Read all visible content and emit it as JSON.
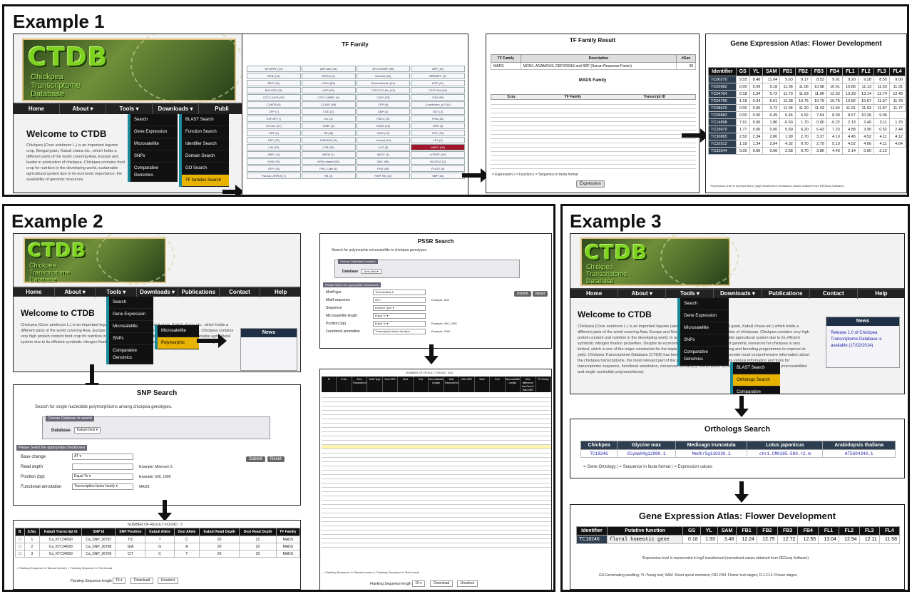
{
  "examples": {
    "e1": "Example 1",
    "e2": "Example 2",
    "e3": "Example 3"
  },
  "banner": {
    "title": "CTDB",
    "sub1": "Chickpea",
    "sub2": "Transcriptome",
    "sub3": "Database"
  },
  "nav": {
    "home": "Home",
    "about": "About ▾",
    "tools": "Tools ▾",
    "downloads": "Downloads ▾",
    "publications": "Publications",
    "contact": "Contact",
    "help": "Help",
    "publ_short": "Publi"
  },
  "welcome": "Welcome to CTDB",
  "tools_menu": [
    "Search",
    "Gene Expression",
    "Microsatellite",
    "SNPs",
    "Comparative Genomics"
  ],
  "search_menu": [
    "BLAST Search",
    "Function Search",
    "Identifier Search",
    "Domain Search",
    "GO Search",
    "TF families Search"
  ],
  "micro_menu": [
    "Microsatellite",
    "Polymorphic"
  ],
  "e3_submenu": [
    "BLAST Search",
    "Orthologs Search",
    "Comparative Expression Search"
  ],
  "tf_family": {
    "title": "TF Family",
    "selected": "MADS (30)",
    "cells": [
      "AP2/ERF (24)",
      "ARF-like (39)",
      "AP2-EREBP (96)",
      "ARF (19)",
      "ARID (11)",
      "ARR-B (9)",
      "Aux/IAA (23)",
      "BBR/BPC (4)",
      "BES1 (5)",
      "bHLH (63)",
      "Bromodomain (14)",
      "bZIP (11)",
      "BHLHRZ (34)",
      "bZIP (63)",
      "C2C2-CO-like (19)",
      "C2C2-Dof (34)",
      "C2C2-GATA (26)",
      "C2C2-YABBY (6)",
      "C2H2 (23)",
      "C3H (55)",
      "CAMTA (5)",
      "CCAAT (46)",
      "CPP (6)",
      "Coactivator_p15 (4)",
      "CPP (7)",
      "CSD (3)",
      "DBP (3)",
      "DDT (2)",
      "E2F-DP (7)",
      "EIL (3)",
      "FAR1 (19)",
      "FHA (18)",
      "GG-like (37)",
      "GeBP (5)",
      "GRAS (45)",
      "GRF (6)",
      "GRF (4)",
      "HB (36)",
      "HMG (10)",
      "HSF (23)",
      "HSF (22)",
      "JUMONJI (11)",
      "Jumonji (11)",
      "LFY (2)",
      "LIM (13)",
      "LOB (35)",
      "LUG (3)",
      "MADS (30)",
      "MBF1 (3)",
      "MED6 (1)",
      "MEDT (1)",
      "mTERF (40)",
      "MYB (76)",
      "MYB-related (53)",
      "NAC (56)",
      "NOZZLE (3)",
      "OFP (15)",
      "PBF-2-like (4)",
      "PHD (36)",
      "PLATZ (8)",
      "Pseudo_ARR-B (7)",
      "RB (4)",
      "RWP-RK (12)",
      "SBP (16)"
    ]
  },
  "tf_result": {
    "title": "TF Family Result",
    "cols": [
      "TF Family",
      "Description",
      "#Gen"
    ],
    "row": [
      "MADS",
      "MCM1, AGAMOUS, DEFICIENS and SRF (Serum Response Factor)",
      "30"
    ],
    "subtitle": "MADS Family",
    "subcols": [
      "S.no.",
      "TF Family",
      "Transcript ID"
    ],
    "button": "Expression",
    "legend": "= Expression | = Function | = Sequence in fasta format"
  },
  "gea1": {
    "title": "Gene Expression Atlas: Flower Development",
    "headers": [
      "Identifier",
      "GS",
      "YL",
      "SAM",
      "FB1",
      "FB2",
      "FB3",
      "FB4",
      "FL1",
      "FL2",
      "FL3",
      "FL4"
    ],
    "rows": [
      [
        "TC00270",
        "9.55",
        "8.48",
        "11.04",
        "9.63",
        "9.17",
        "8.53",
        "9.01",
        "9.20",
        "9.28",
        "8.55",
        "9.00"
      ],
      [
        "TC02682",
        "0.00",
        "5.99",
        "5.18",
        "11.36",
        "11.06",
        "10.98",
        "10.61",
        "10.86",
        "11.13",
        "11.63",
        "11.31"
      ],
      [
        "TC04764",
        "0.18",
        "2.34",
        "5.72",
        "11.70",
        "11.63",
        "11.96",
        "12.32",
        "13.28",
        "13.14",
        "12.74",
        "12.45"
      ],
      [
        "TC04790",
        "1.18",
        "0.34",
        "6.61",
        "11.38",
        "10.75",
        "10.79",
        "10.75",
        "10.82",
        "10.67",
        "11.57",
        "11.78"
      ],
      [
        "TC08620",
        "0.00",
        "0.00",
        "3.72",
        "11.04",
        "11.20",
        "11.43",
        "11.64",
        "11.91",
        "11.93",
        "11.87",
        "11.77"
      ],
      [
        "TC09882",
        "0.00",
        "0.00",
        "6.39",
        "6.46",
        "6.92",
        "7.54",
        "8.30",
        "8.67",
        "10.36",
        "9.96"
      ],
      [
        "TC14898",
        "7.91",
        "0.00",
        "1.80",
        "-0.60",
        "1.70",
        "0.00",
        "-0.22",
        "2.13",
        "2.40",
        "3.11",
        "1.70"
      ],
      [
        "TC29470",
        "1.77",
        "0.00",
        "0.00",
        "5.60",
        "6.20",
        "6.43",
        "7.23",
        "4.88",
        "3.90",
        "0.52",
        "2.44"
      ],
      [
        "TC30865",
        "2.50",
        "2.34",
        "2.80",
        "1.99",
        "2.70",
        "3.37",
        "4.10",
        "4.45",
        "4.52",
        "4.11",
        "4.12"
      ],
      [
        "TC32512",
        "1.18",
        "1.34",
        "2.94",
        "4.32",
        "0.70",
        "2.79",
        "5.10",
        "4.52",
        "4.06",
        "4.11",
        "4.64"
      ],
      [
        "TC32544",
        "0.00",
        "0.00",
        "0.00",
        "2.58",
        "0.70",
        "3.86",
        "4.43",
        "2.14",
        "0.00",
        "2.12"
      ]
    ],
    "footnote": "*Expression level is represented in (log2 transformed normalized values obtained from DEGseq Software)."
  },
  "snp": {
    "title": "SNP Search",
    "intro": "Search for single nucleotide polymorphisms among chickpea genotypes.",
    "db_box": "Choose Database to search",
    "db_label": "Database",
    "db_value": "Kabuli-Desi ▾",
    "params": "Please Select the appropriate checkboxes",
    "fields": [
      [
        "Base change",
        "AT ▾",
        ""
      ],
      [
        "Read depth",
        "",
        "Example: Minimum 3"
      ],
      [
        "Position (bp)",
        "Equal To ▾",
        "Example: 500, 1000"
      ],
      [
        "Functional annotation",
        "Transcription factor family ▾",
        "MADS"
      ]
    ],
    "submit": "Submit",
    "reset": "Reset",
    "result": "NUMBER OF RESULT FOUND : 3",
    "cols": [
      "B",
      "S.No.",
      "Kabuli Transcript Id",
      "SNP Id",
      "SNP Position",
      "Kabuli Allele",
      "Desi Allele",
      "Kabuli Read Depth",
      "Desi Read Depth",
      "TF Family"
    ],
    "rows": [
      [
        "1",
        "Ca_KTC04590",
        "Ca_SNP_36797",
        "T/C",
        "T",
        "C",
        "20",
        "21",
        "MADS"
      ],
      [
        "2",
        "Ca_KTC04590",
        "Ca_SNP_36798",
        "G/A",
        "G",
        "A",
        "20",
        "20",
        "MADS"
      ],
      [
        "3",
        "Ca_KTC04590",
        "Ca_SNP_36799",
        "C/T",
        "C",
        "T",
        "20",
        "20",
        "MADS"
      ]
    ],
    "legend": "= Flanking Sequence in Tabular format | = Flanking Sequence in Text format",
    "flank_label": "Flanking Sequence length",
    "flank_value": "15 ▾",
    "download": "Download",
    "unselect": "Unselect"
  },
  "pssr": {
    "title": "PSSR Search",
    "intro": "Search for polymorphic microsatellite in chickpea genotypes.",
    "db_box": "Choose Database to search",
    "db_label": "Database",
    "db_value": "Desi-Wild ▾",
    "params": "Please Select the appropriate checkboxes",
    "fields": [
      [
        "Motif type",
        "Trinucleotide ▾",
        ""
      ],
      [
        "Motif sequence",
        "ATC",
        "Example: ATA"
      ],
      [
        "Sequence",
        "Desired Type ▾",
        ""
      ],
      [
        "Microsatellite length",
        "Equal To ▾",
        ""
      ],
      [
        "Position (bp)",
        "Equal To ▾",
        "Example: 400, 1000"
      ],
      [
        "Functional annotation",
        "Transcription factor family ▾",
        "Example: CAN"
      ]
    ],
    "submit": "Submit",
    "reset": "Reset",
    "result": "NUMBER OF RESULT FOUND : 304",
    "cols": [
      "B",
      "S.No.",
      "Desi Transcript Id",
      "Motif Type",
      "Desi SSR",
      "Start",
      "End",
      "Microsatellite Length",
      "Wild Transcript Id",
      "Wild SSR",
      "Start",
      "End",
      "Microsatellite Length",
      "Size difference b/w Desi & Wild SSR",
      "TF Family"
    ],
    "legend": "= Flanking Sequence in Tabular format | = Flanking Sequence in Text format",
    "flank_label": "Flanking Sequence length",
    "flank_value": "15 ▾",
    "download": "Download",
    "unselect": "Unselect"
  },
  "news": {
    "title": "News",
    "text": "Release 1.0 of Chickpea Transcriptome Database is available (17/02/2014)"
  },
  "orthologs": {
    "title": "Orthologs Search",
    "cols": [
      "Chickpea",
      "Glycine max",
      "Medicago truncatula",
      "Lotus japonicus",
      "Arabidopsis thaliana"
    ],
    "row": [
      "TC18246",
      "Glyma04g12980.1",
      "Medtr5g110330.1",
      "chr1.CM0185.580.r2.m",
      "AT5G04340.1"
    ],
    "legend": "= Gene Ontology | = Sequence in fasta format | = Expression values"
  },
  "gea3": {
    "title": "Gene Expression Atlas: Flower Development",
    "headers": [
      "Identifier",
      "Putative function",
      "GS",
      "YL",
      "SAM",
      "FB1",
      "FB2",
      "FB3",
      "FB4",
      "FL1",
      "FL2",
      "FL3",
      "FL4"
    ],
    "row": [
      "TC18246",
      "floral homeotic gene",
      "0.18",
      "1.93",
      "3.48",
      "12.24",
      "12.75",
      "12.72",
      "12.55",
      "13.04",
      "12.94",
      "12.11",
      "11.58"
    ],
    "note1": "*Expression level is represented in log2 transformed (normalized values obtained from DEGseq Software).",
    "note2": "GS:Germinating seedling; YL:Young leaf; SAM: Shoot apical meristem; FB1-FB4: Flower bud stages; FL1-FL4: Flower stages."
  }
}
